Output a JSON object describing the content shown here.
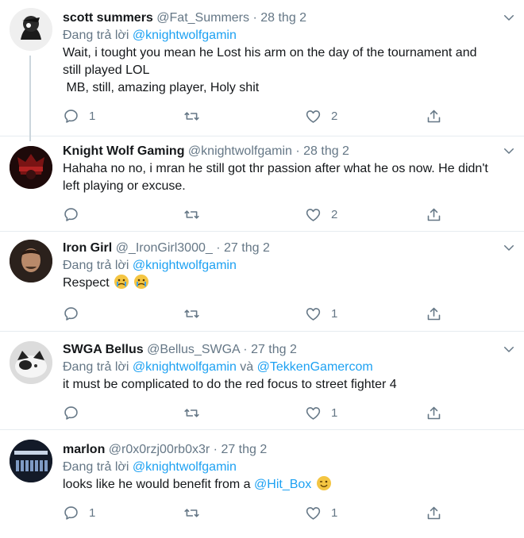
{
  "tweets": [
    {
      "name": "scott summers",
      "handle": "@Fat_Summers",
      "separator": "·",
      "time": "28 thg 2",
      "reply_prefix": "Đang trả lời",
      "reply_to_1": "@knightwolfgamin",
      "reply_joiner": "",
      "reply_to_2": "",
      "text_line_1": "Wait, i tought you mean he Lost his arm on the day of the tournament and",
      "text_line_2": "still played LOL",
      "text_line_3": " MB, still, amazing player, Holy shit",
      "text_mention": "",
      "reply_count": "1",
      "retweet_count": "",
      "like_count": "2"
    },
    {
      "name": "Knight Wolf Gaming",
      "handle": "@knightwolfgamin",
      "separator": "·",
      "time": "28 thg 2",
      "text_line_1": "Hahaha no no, i mran he still got thr passion after what he os now. He didn't",
      "text_line_2": "left playing or excuse.",
      "reply_count": "",
      "retweet_count": "",
      "like_count": "2"
    },
    {
      "name": "Iron Girl",
      "handle": "@_IronGirl3000_",
      "separator": "·",
      "time": "27 thg 2",
      "reply_prefix": "Đang trả lời",
      "reply_to_1": "@knightwolfgamin",
      "text_line_1": "Respect",
      "emojis": [
        "crying-face",
        "crying-face"
      ],
      "reply_count": "",
      "retweet_count": "",
      "like_count": "1"
    },
    {
      "name": "SWGA Bellus",
      "handle": "@Bellus_SWGA",
      "separator": "·",
      "time": "27 thg 2",
      "reply_prefix": "Đang trả lời",
      "reply_to_1": "@knightwolfgamin",
      "reply_joiner": "và",
      "reply_to_2": "@TekkenGamercom",
      "text_line_1": "it must be complicated to do the red focus to street fighter 4",
      "reply_count": "",
      "retweet_count": "",
      "like_count": "1"
    },
    {
      "name": "marlon",
      "handle": "@r0x0rzj00rb0x3r",
      "separator": "·",
      "time": "27 thg 2",
      "reply_prefix": "Đang trả lời",
      "reply_to_1": "@knightwolfgamin",
      "text_line_1": "looks like he would benefit from a",
      "text_mention": "@Hit_Box",
      "emojis": [
        "winking-face"
      ],
      "reply_count": "1",
      "retweet_count": "",
      "like_count": "1"
    }
  ],
  "colors": {
    "accent": "#1da1f2",
    "muted": "#657786",
    "divider": "#e6ecf0",
    "text": "#14171a"
  },
  "icons": [
    "reply-icon",
    "retweet-icon",
    "like-icon",
    "share-icon",
    "caret-down-icon"
  ]
}
